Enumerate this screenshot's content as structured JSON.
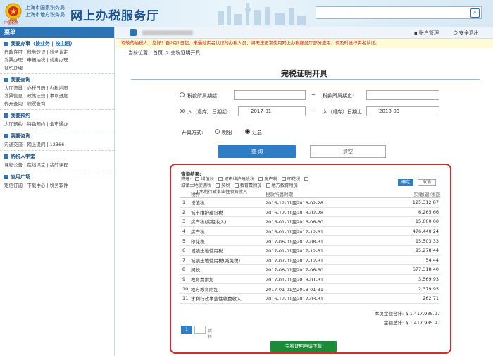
{
  "header": {
    "org_line1": "上海市国家税务局",
    "org_line2": "上海市地方税务局",
    "site_title": "网上办税服务厅",
    "emblem_text": "中国税务",
    "search_placeholder": ""
  },
  "sidebar": {
    "title": "菜单",
    "sections": [
      {
        "title_prefix": "我要办事（",
        "title_hl1": "按业务",
        "title_mid": " | ",
        "title_hl2": "按主题",
        "title_suffix": "）",
        "lines": [
          "行政许可 | 税务登记 | 税务认定",
          "发票办理 | 申报纳税 | 优惠办理",
          "证明办理"
        ]
      },
      {
        "title": "我要查询",
        "lines": [
          "大厅流量 | 办税日历 | 办税地图",
          "发票信息 | 政策法规 | 事项进度",
          "代开查询 | 领票查询"
        ]
      },
      {
        "title": "我要预约",
        "lines": [
          "大厅预约 | 特色预约 | 全市通办"
        ]
      },
      {
        "title": "我要咨询",
        "lines": [
          "沟通交流 | 网上提问 | 12366"
        ]
      },
      {
        "title": "纳税人学堂",
        "lines": [
          "课程公告 | 在线课堂 | 我的课程"
        ]
      },
      {
        "title": "应用广场",
        "lines": [
          "短信订阅 | 下载中心 | 税务软件"
        ]
      }
    ]
  },
  "topbar": {
    "account": "账户管理",
    "logout": "安全退出"
  },
  "notice": "尊敬的纳税人：您好！自2月1日起，未通过实名认证的办税人员，将无法正常使用网上办税服务厅部分应用，请及时进行实名认证。",
  "breadcrumb": "当前位置：首页 ＞ 完税证明开具",
  "page_title": "完税证明开具",
  "form": {
    "period_start_label": "税款所属期起:",
    "period_end_label": "税款所属期止:",
    "entry_start_label": "入（退库）日期起:",
    "entry_end_label": "入（退库）日期止:",
    "entry_start_value": "2017-01",
    "entry_end_value": "2018-03",
    "range_sep": "~",
    "mode_label": "开具方式:",
    "mode_detail": "明细",
    "mode_summary": "汇总",
    "query_button": "查 询",
    "clear_button": "清空"
  },
  "result": {
    "title": "查询结果:",
    "filter_label": "筛选:",
    "filter_options": [
      "增值税",
      "城市维护建设税",
      "房产税",
      "印花税",
      "城镇土地使用税",
      "契税",
      "教育费附加",
      "地方教育附加",
      "水利行政事业性收费收入"
    ],
    "ok_button": "确定",
    "cancel_button": "取消",
    "columns": [
      "税种",
      "税款所属时期",
      "实缴(退)税额"
    ],
    "rows": [
      {
        "n": "1",
        "tax": "增值税",
        "period": "2016-12-01至2018-02-28",
        "amount": "125,312.87"
      },
      {
        "n": "2",
        "tax": "城市维护建设税",
        "period": "2016-12-01至2018-02-28",
        "amount": "6,265.66"
      },
      {
        "n": "3",
        "tax": "房产税(房租收入)",
        "period": "2016-01-01至2016-06-30",
        "amount": "15,600.00"
      },
      {
        "n": "4",
        "tax": "房产税",
        "period": "2016-01-01至2017-12-31",
        "amount": "476,440.24"
      },
      {
        "n": "5",
        "tax": "印花税",
        "period": "2017-06-01至2017-08-31",
        "amount": "15,503.33"
      },
      {
        "n": "6",
        "tax": "城镇土地使用税",
        "period": "2017-01-01至2017-12-31",
        "amount": "95,278.44"
      },
      {
        "n": "7",
        "tax": "城镇土地使用税(减免税)",
        "period": "2017-07-01至2017-12-31",
        "amount": "54.44"
      },
      {
        "n": "8",
        "tax": "契税",
        "period": "2017-06-01至2017-06-30",
        "amount": "677,318.40"
      },
      {
        "n": "9",
        "tax": "教育费附加",
        "period": "2017-01-01至2018-01-31",
        "amount": "3,569.93"
      },
      {
        "n": "10",
        "tax": "地方教育附加",
        "period": "2017-01-01至2018-01-31",
        "amount": "2,379.95"
      },
      {
        "n": "11",
        "tax": "水利行政事业性收费收入",
        "period": "2016-12-01至2017-03-31",
        "amount": "262.71"
      }
    ],
    "page_total": "本页金额合计: ￥1,417,985.97",
    "grand_total": "金额总计: ￥1,417,985.97",
    "current_page": "1",
    "go_label": "跳转",
    "download_button": "完税证明申请下载"
  }
}
